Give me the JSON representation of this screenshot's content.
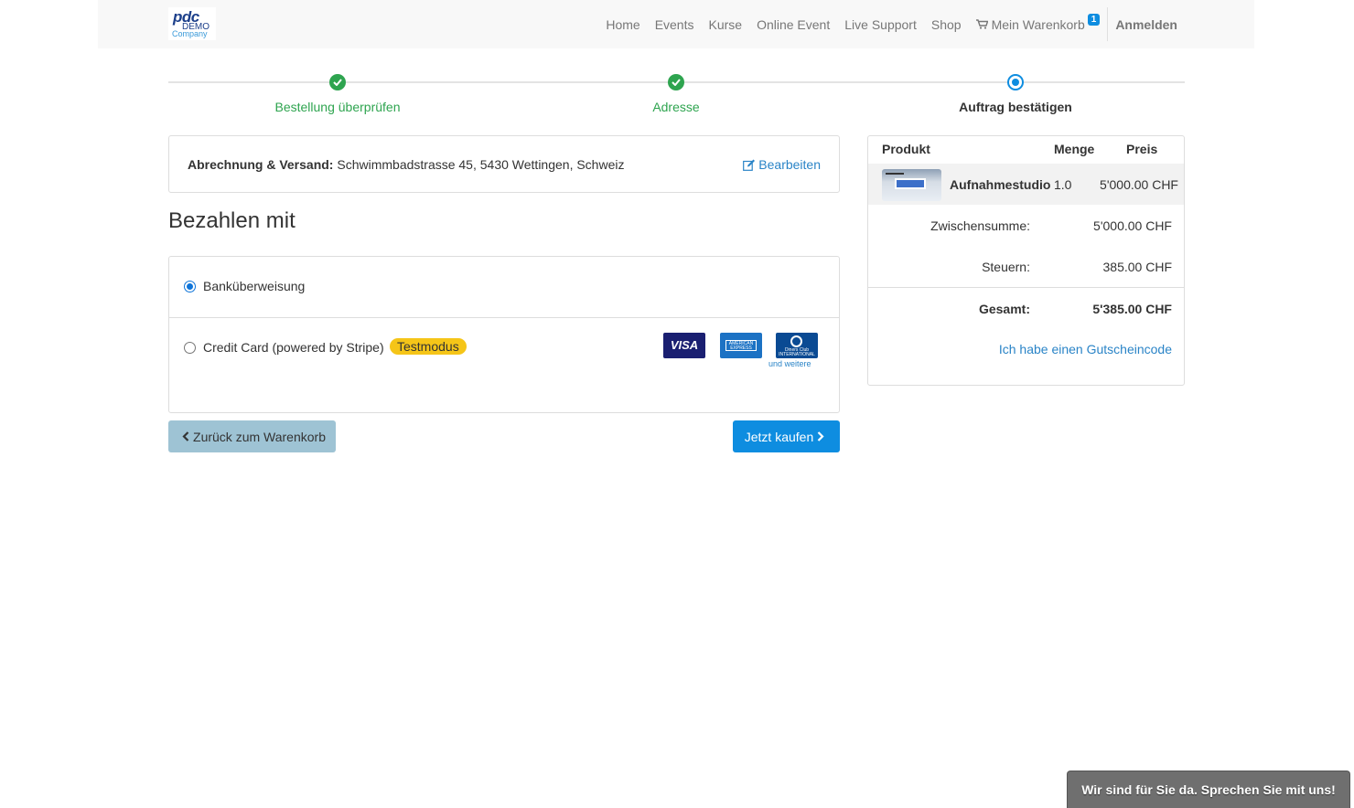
{
  "logo": {
    "line1": "pdc",
    "line2": "DEMO",
    "line3": "Company"
  },
  "nav": {
    "items": [
      "Home",
      "Events",
      "Kurse",
      "Online Event",
      "Live Support",
      "Shop"
    ],
    "cart_label": "Mein Warenkorb",
    "cart_count": "1",
    "login_label": "Anmelden"
  },
  "steps": [
    {
      "label": "Bestellung überprüfen",
      "state": "done"
    },
    {
      "label": "Adresse",
      "state": "done"
    },
    {
      "label": "Auftrag bestätigen",
      "state": "current"
    }
  ],
  "address": {
    "label": "Abrechnung & Versand:",
    "value": "Schwimmbadstrasse 45, 5430 Wettingen, Schweiz",
    "edit_label": "Bearbeiten"
  },
  "payment": {
    "title": "Bezahlen mit",
    "methods": [
      {
        "label": "Banküberweisung",
        "selected": true
      },
      {
        "label": "Credit Card (powered by Stripe)",
        "selected": false,
        "badge": "Testmodus"
      }
    ],
    "cards": {
      "visa": "VISA",
      "amex": "AMERICAN EXPRESS",
      "diners": "Diners Club INTERNATIONAL"
    },
    "more_label": "und weitere"
  },
  "buttons": {
    "back": "Zurück zum Warenkorb",
    "buy": "Jetzt kaufen"
  },
  "summary": {
    "headers": {
      "product": "Produkt",
      "qty": "Menge",
      "price": "Preis"
    },
    "items": [
      {
        "name": "Aufnahmestudio",
        "qty": "1.0",
        "price": "5'000.00 CHF"
      }
    ],
    "subtotal_label": "Zwischensumme:",
    "subtotal": "5'000.00 CHF",
    "tax_label": "Steuern:",
    "tax": "385.00 CHF",
    "total_label": "Gesamt:",
    "total": "5'385.00 CHF",
    "voucher_label": "Ich habe einen Gutscheincode"
  },
  "chat": {
    "label": "Wir sind für Sie da. Sprechen Sie mit uns!"
  },
  "colors": {
    "accent": "#0e8de0",
    "success": "#2ea44f",
    "badge": "#f5c518"
  }
}
